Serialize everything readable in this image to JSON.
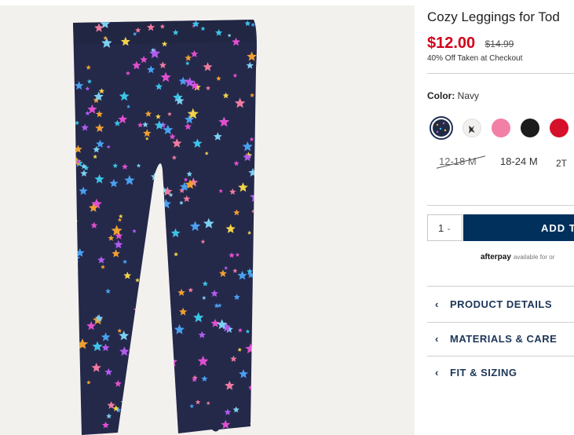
{
  "product": {
    "title": "Cozy Leggings for Tod",
    "price": "$12.00",
    "original_price": "$14.99",
    "promo": "40% Off Taken at Checkout"
  },
  "color": {
    "label": "Color:",
    "value": "Navy",
    "swatches": [
      {
        "name": "navy-stars",
        "hex": "#222a45",
        "selected": true
      },
      {
        "name": "white-print",
        "hex": "#f2f0ee",
        "selected": false
      },
      {
        "name": "pink",
        "hex": "#f27fa6",
        "selected": false
      },
      {
        "name": "black",
        "hex": "#1c1c1c",
        "selected": false
      },
      {
        "name": "red",
        "hex": "#d5102b",
        "selected": false
      }
    ]
  },
  "sizes": [
    {
      "label": "12-18 M",
      "available": false
    },
    {
      "label": "18-24 M",
      "available": true
    },
    {
      "label": "2T",
      "available": true
    }
  ],
  "cart": {
    "quantity": "1",
    "add_label": "ADD T"
  },
  "afterpay": {
    "logo": "afterpay",
    "text": "available for or"
  },
  "accordions": [
    {
      "label": "PRODUCT DETAILS"
    },
    {
      "label": "MATERIALS & CARE"
    },
    {
      "label": "FIT & SIZING"
    }
  ],
  "colors": {
    "price_red": "#d0021b",
    "navy": "#00305b",
    "leggings_navy": "#24294a"
  }
}
